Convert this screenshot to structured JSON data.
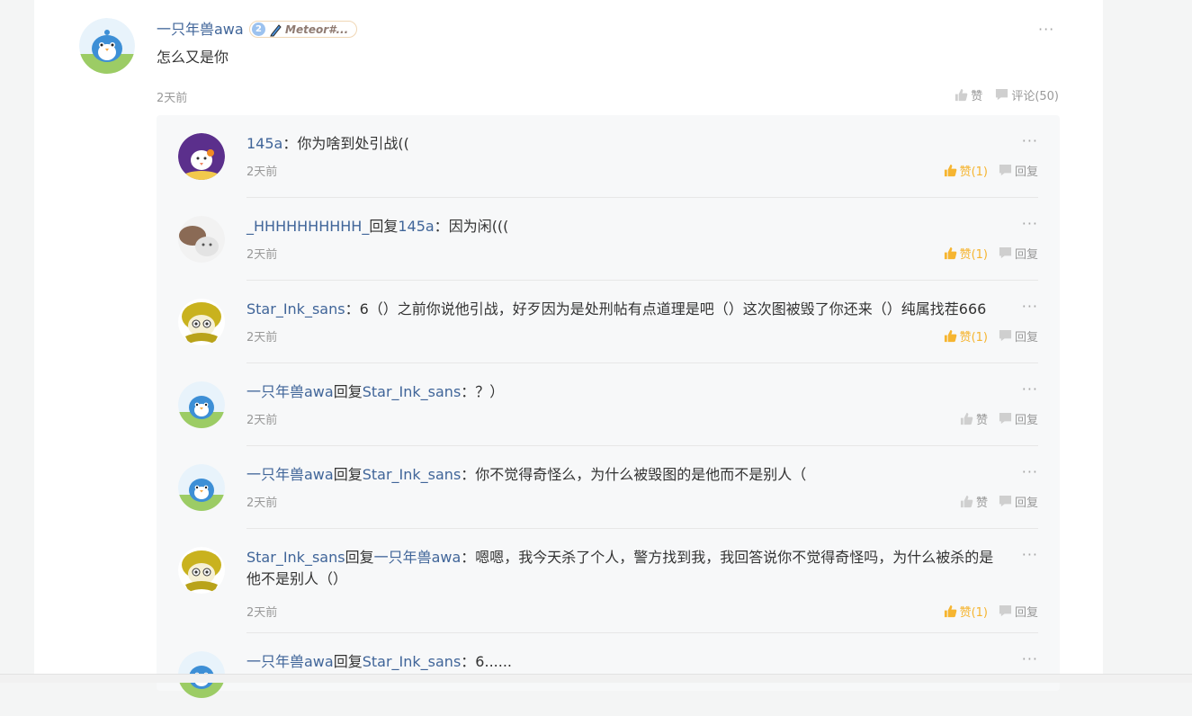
{
  "post": {
    "author": "一只年兽awa",
    "level": "2",
    "badge_text": "Meteor#...",
    "content": "怎么又是你",
    "time": "2天前",
    "like_label": "赞",
    "comment_label": "评论(50)"
  },
  "replies": [
    {
      "user": "145a",
      "reply_to": "",
      "content": "你为啥到处引战((",
      "time": "2天前",
      "like_label": "赞(1)",
      "liked": true,
      "reply_label": "回复"
    },
    {
      "user": "_HHHHHHHHHH_",
      "reply_to": "145a",
      "content": "因为闲(((",
      "time": "2天前",
      "like_label": "赞(1)",
      "liked": true,
      "reply_label": "回复"
    },
    {
      "user": "Star_Ink_sans",
      "reply_to": "",
      "content": "6（）之前你说他引战，好歹因为是处刑帖有点道理是吧（）这次图被毁了你还来（）纯属找茬666",
      "time": "2天前",
      "like_label": "赞(1)",
      "liked": true,
      "reply_label": "回复"
    },
    {
      "user": "一只年兽awa",
      "reply_to": "Star_Ink_sans",
      "content": "？）",
      "time": "2天前",
      "like_label": "赞",
      "liked": false,
      "reply_label": "回复"
    },
    {
      "user": "一只年兽awa",
      "reply_to": "Star_Ink_sans",
      "content": "你不觉得奇怪么，为什么被毁图的是他而不是别人（",
      "time": "2天前",
      "like_label": "赞",
      "liked": false,
      "reply_label": "回复"
    },
    {
      "user": "Star_Ink_sans",
      "reply_to": "一只年兽awa",
      "content": "嗯嗯，我今天杀了个人，警方找到我，我回答说你不觉得奇怪吗，为什么被杀的是他不是别人（）",
      "time": "2天前",
      "like_label": "赞(1)",
      "liked": true,
      "reply_label": "回复"
    },
    {
      "user": "一只年兽awa",
      "reply_to": "Star_Ink_sans",
      "content": "6......",
      "time": "",
      "like_label": "",
      "liked": false,
      "reply_label": ""
    }
  ],
  "labels": {
    "reply_word": "回复",
    "colon": "："
  },
  "colors": {
    "link": "#406599",
    "liked": "#f6b531",
    "muted": "#999999",
    "reply_bg": "#f7f8f9"
  }
}
